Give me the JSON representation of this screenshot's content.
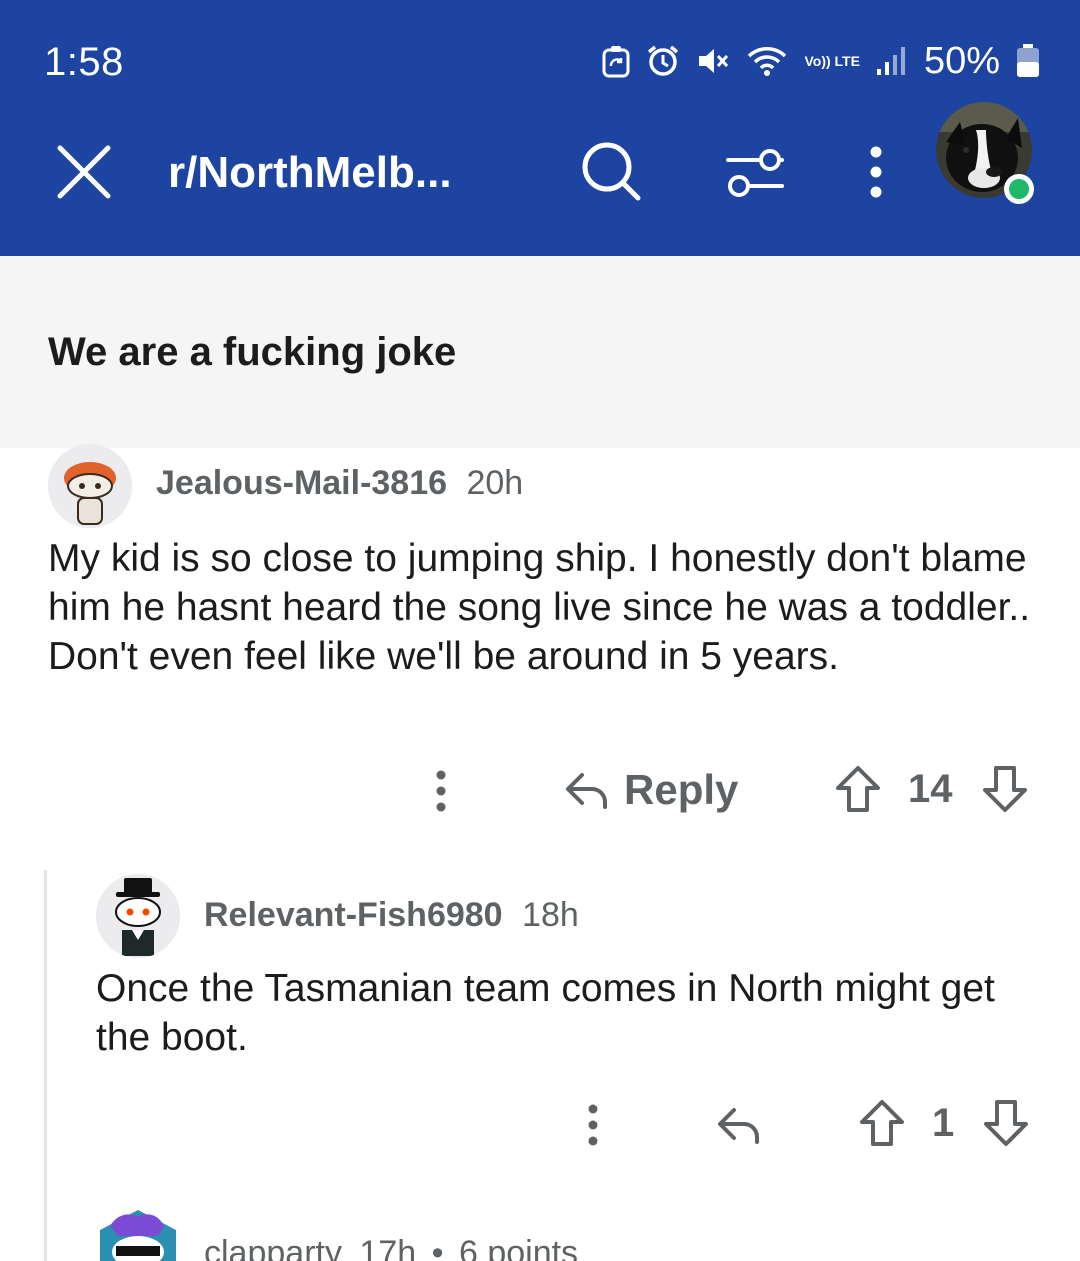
{
  "status_bar": {
    "time": "1:58",
    "battery": "50%",
    "network": "Vo)) LTE"
  },
  "toolbar": {
    "title": "r/NorthMelb...",
    "icons": [
      "close-icon",
      "search-icon",
      "filter-icon",
      "more-vertical-icon",
      "user-avatar"
    ]
  },
  "post": {
    "title": "We are a fucking joke"
  },
  "comments": [
    {
      "username": "Jealous-Mail-3816",
      "time": "20h",
      "text": "My kid is so close to jumping ship. I honestly don't blame him he hasnt heard the song live since he was a toddler.. Don't even feel like we'll be around in 5 years.",
      "reply_label": "Reply",
      "score": "14"
    },
    {
      "username": "Relevant-Fish6980",
      "time": "18h",
      "text": "Once the Tasmanian team comes in North might get the boot.",
      "score": "1"
    },
    {
      "username": "clapparty",
      "time": "17h",
      "extra": "6 points"
    }
  ],
  "colors": {
    "header_bg": "#1c44a0",
    "title_band_bg": "#f5f5f5",
    "meta_text": "#5e6264",
    "online": "#1fb86a"
  }
}
